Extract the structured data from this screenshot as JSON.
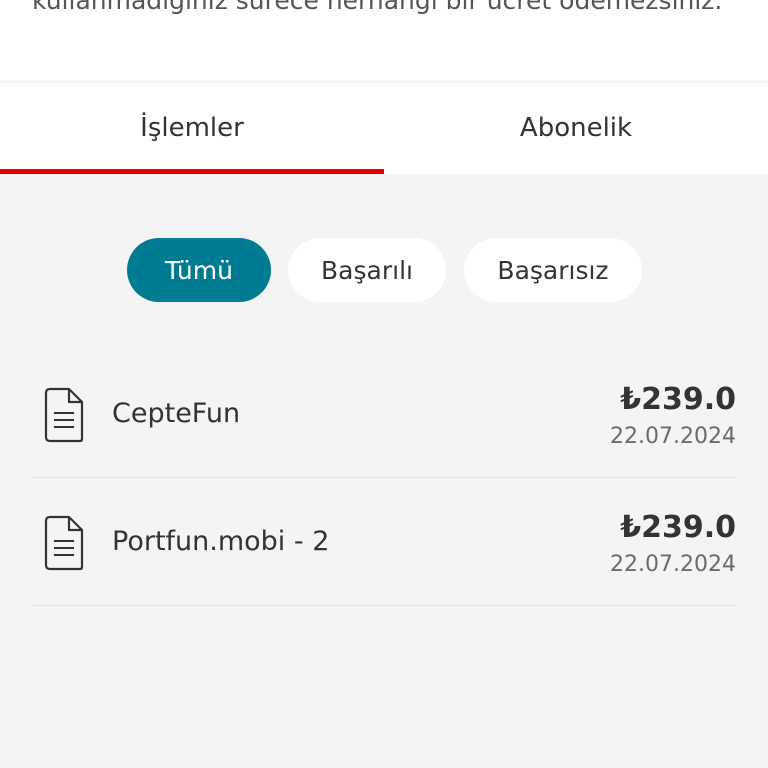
{
  "info": {
    "text": "kullanmadığınız sürece herhangi bir ücret ödemezsiniz."
  },
  "tabs": [
    {
      "label": "İşlemler",
      "active": true
    },
    {
      "label": "Abonelik",
      "active": false
    }
  ],
  "filters": [
    {
      "label": "Tümü",
      "selected": true
    },
    {
      "label": "Başarılı",
      "selected": false
    },
    {
      "label": "Başarısız",
      "selected": false
    }
  ],
  "transactions": [
    {
      "name": "CepteFun",
      "amount": "₺239.0",
      "date": "22.07.2024",
      "icon": "document-icon"
    },
    {
      "name": "Portfun.mobi - 2",
      "amount": "₺239.0",
      "date": "22.07.2024",
      "icon": "document-icon"
    }
  ],
  "colors": {
    "accent": "#e60000",
    "selected_pill": "#007c92",
    "background": "#f4f4f4"
  }
}
